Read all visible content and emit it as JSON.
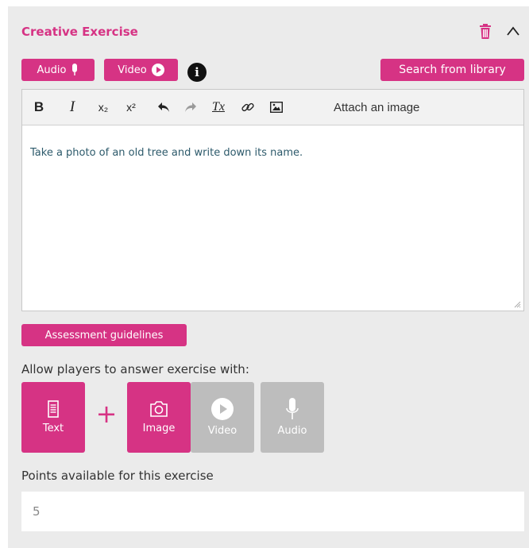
{
  "exercise": {
    "title": "Creative Exercise",
    "icons": {
      "delete": "trash-icon",
      "collapse": "chevron-up-icon"
    }
  },
  "media_buttons": {
    "audio_label": "Audio",
    "video_label": "Video",
    "info_symbol": "i",
    "search_label": "Search from library"
  },
  "editor": {
    "toolbar": {
      "bold": "B",
      "italic": "I",
      "subscript": "x₂",
      "superscript": "x²",
      "clear_format": "Tx",
      "attach_label": "Attach an image"
    },
    "content": "Take a photo of an old tree and write down its name."
  },
  "assessment_label": "Assessment guidelines",
  "answer_options": {
    "label": "Allow players to answer exercise with:",
    "plus": "+",
    "items": [
      {
        "label": "Text",
        "enabled": true,
        "icon": "text-document-icon"
      },
      {
        "label": "Image",
        "enabled": true,
        "icon": "camera-icon"
      },
      {
        "label": "Video",
        "enabled": false,
        "icon": "play-icon"
      },
      {
        "label": "Audio",
        "enabled": false,
        "icon": "microphone-icon"
      }
    ]
  },
  "points": {
    "label": "Points available for this exercise",
    "value": "5"
  },
  "colors": {
    "accent": "#d63384",
    "disabled": "#bdbdbd",
    "panel": "#ebebeb"
  }
}
